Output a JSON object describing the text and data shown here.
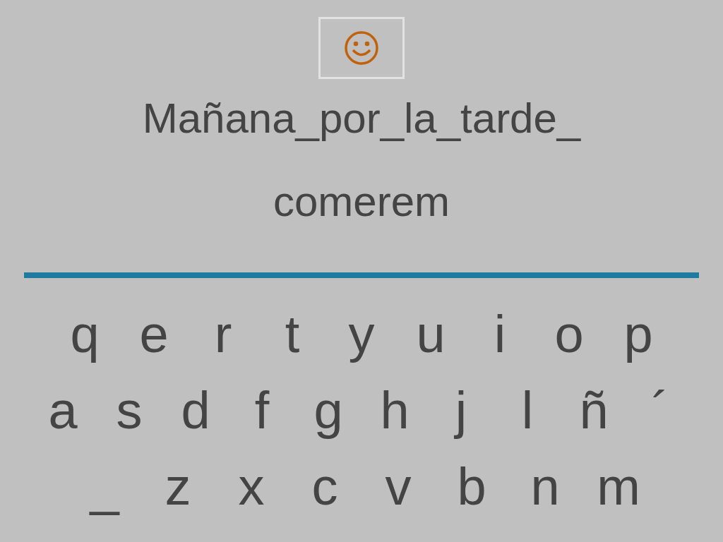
{
  "prompt": {
    "lines": [
      "Mañana_por_la_tarde_",
      "comerem"
    ]
  },
  "keyboard": {
    "rows": [
      [
        "q",
        "e",
        "r",
        "t",
        "y",
        "u",
        "i",
        "o",
        "p"
      ],
      [
        "a",
        "s",
        "d",
        "f",
        "g",
        "h",
        "j",
        "l",
        "ñ",
        "´"
      ],
      [
        "_",
        "z",
        "x",
        "c",
        "v",
        "b",
        "n",
        "m"
      ]
    ]
  }
}
